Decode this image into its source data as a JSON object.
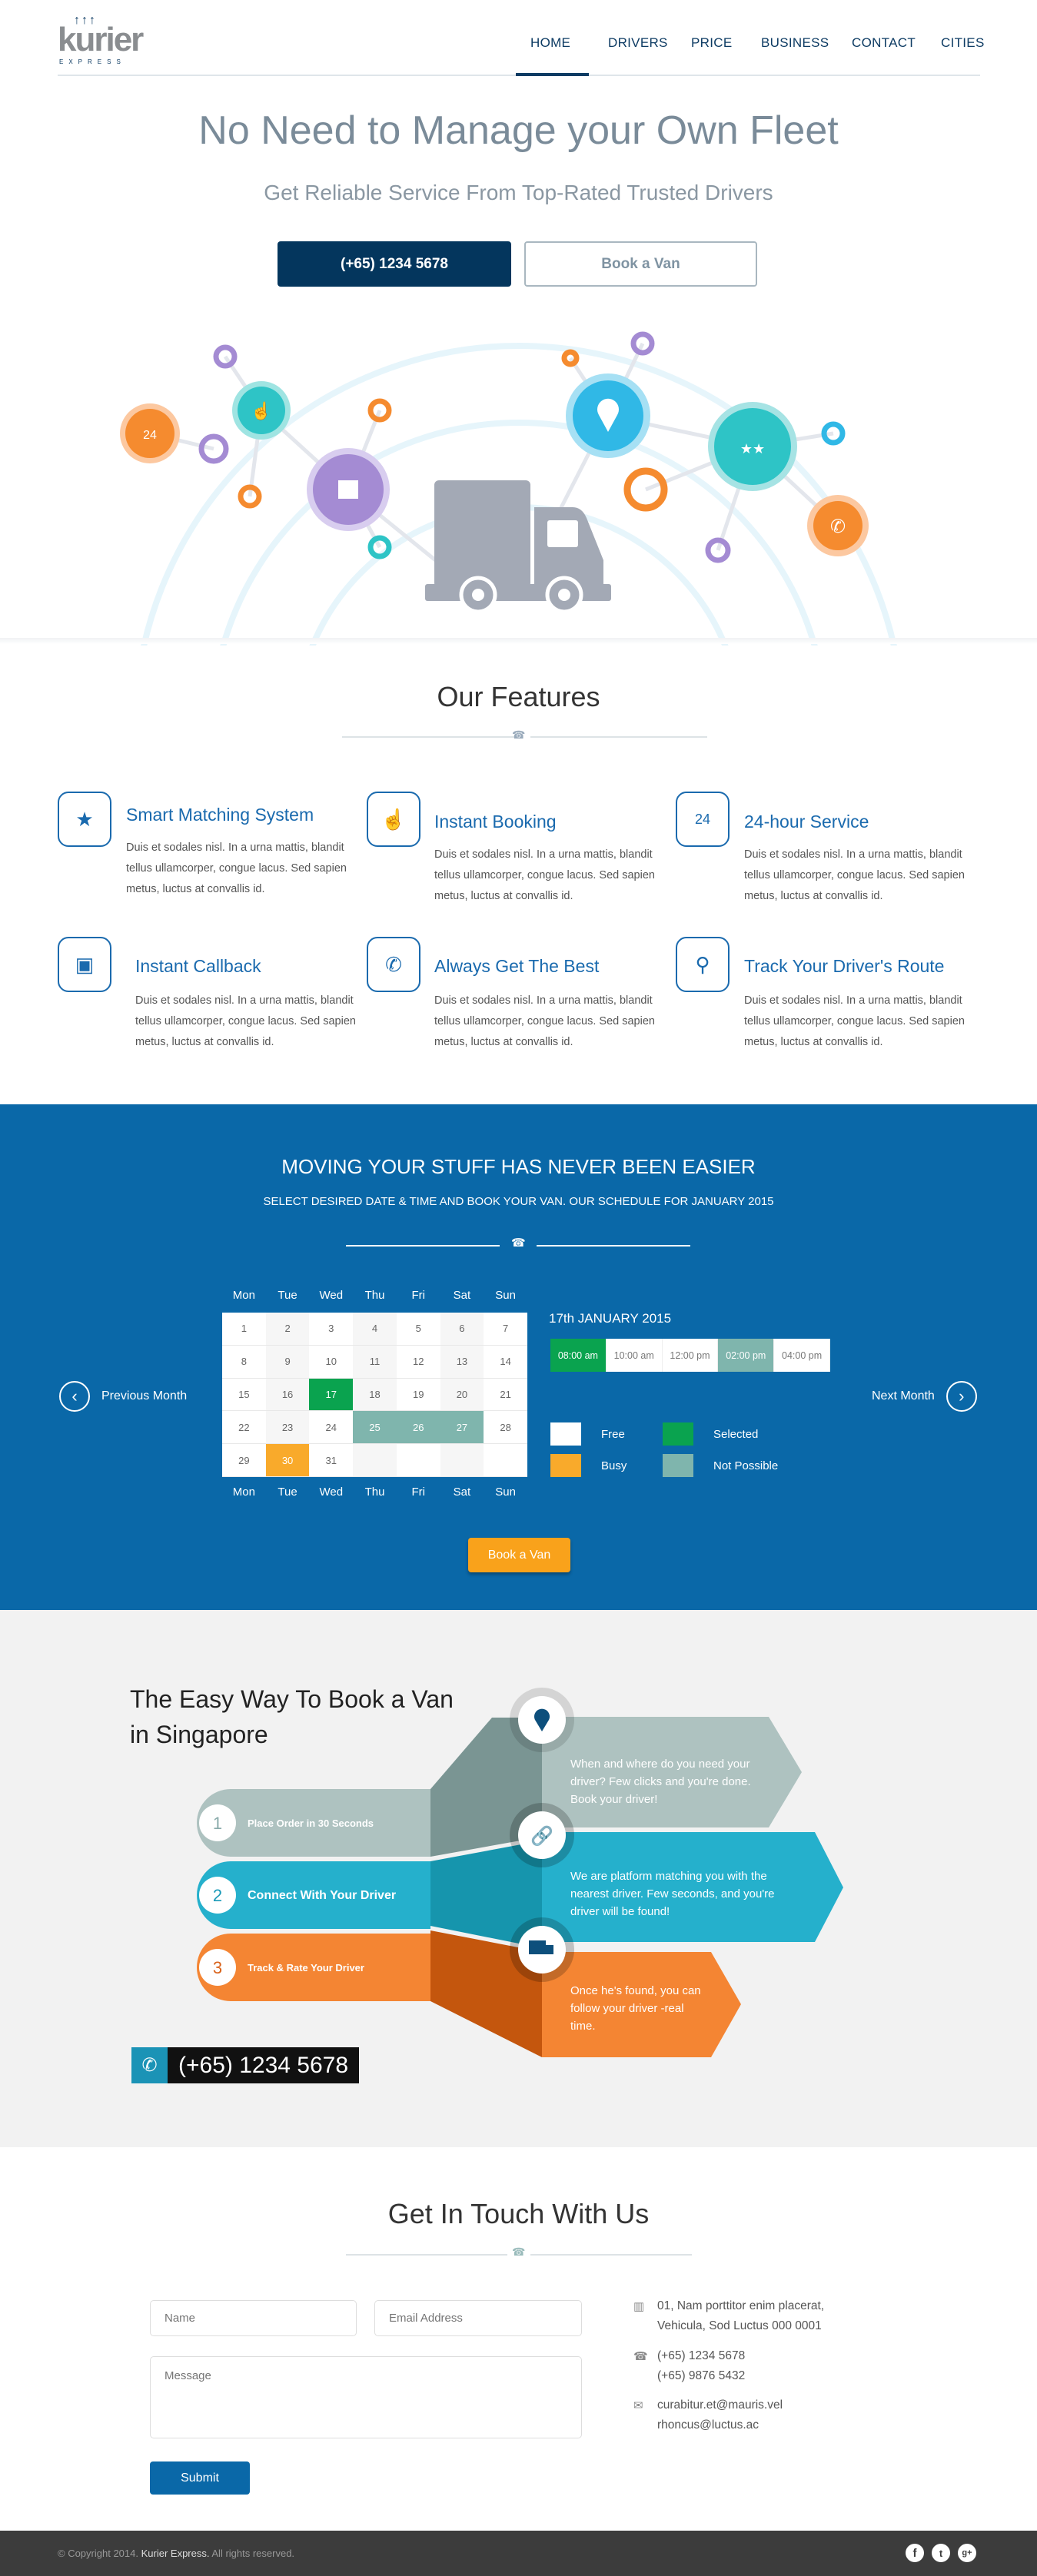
{
  "brand": {
    "name": "kurier",
    "tagline": "EXPRESS"
  },
  "nav": {
    "items": [
      "HOME",
      "DRIVERS",
      "PRICE",
      "BUSINESS",
      "CONTACT",
      "CITIES"
    ],
    "active": "HOME"
  },
  "hero": {
    "title": "No Need to Manage your Own Fleet",
    "subtitle": "Get Reliable Service From Top-Rated Trusted Drivers",
    "phone_button": "(+65) 1234 5678",
    "book_button": "Book a Van"
  },
  "features": {
    "title": "Our Features",
    "items": [
      {
        "icon": "stars-icon",
        "title": "Smart Matching System",
        "text": "Duis et sodales nisl. In a urna mattis, blandit tellus ullamcorper, congue lacus. Sed sapien metus, luctus at convallis id."
      },
      {
        "icon": "hand-pointer-icon",
        "title": "Instant Booking",
        "text": "Duis et sodales nisl. In a urna mattis, blandit tellus ullamcorper, congue lacus. Sed sapien metus, luctus at convallis id."
      },
      {
        "icon": "phone-24-icon",
        "title": "24-hour Service",
        "text": "Duis et sodales nisl. In a urna mattis, blandit tellus ullamcorper, congue lacus. Sed sapien metus, luctus at convallis id."
      },
      {
        "icon": "box-icon",
        "title": "Instant Callback",
        "text": "Duis et sodales nisl. In a urna mattis, blandit tellus ullamcorper, congue lacus. Sed sapien metus, luctus at convallis id."
      },
      {
        "icon": "phone-icon",
        "title": "Always Get The Best",
        "text": "Duis et sodales nisl. In a urna mattis, blandit tellus ullamcorper, congue lacus. Sed sapien metus, luctus at convallis id."
      },
      {
        "icon": "map-pin-icon",
        "title": "Track Your Driver's Route",
        "text": "Duis et sodales nisl. In a urna mattis, blandit tellus ullamcorper, congue lacus. Sed sapien metus, luctus at convallis id."
      }
    ]
  },
  "booking": {
    "title": "MOVING YOUR STUFF HAS NEVER BEEN EASIER",
    "subtitle": "SELECT DESIRED DATE & TIME AND BOOK YOUR VAN. OUR SCHEDULE FOR JANUARY 2015",
    "weekdays": [
      "Mon",
      "Tue",
      "Wed",
      "Thu",
      "Fri",
      "Sat",
      "Sun"
    ],
    "prev": "Previous Month",
    "next": "Next Month",
    "selected_date": "17th JANUARY 2015",
    "days": [
      1,
      2,
      3,
      4,
      5,
      6,
      7,
      8,
      9,
      10,
      11,
      12,
      13,
      14,
      15,
      16,
      17,
      18,
      19,
      20,
      21,
      22,
      23,
      24,
      25,
      26,
      27,
      28,
      29,
      30,
      31
    ],
    "day_status": {
      "17": "selected",
      "25": "np",
      "26": "np",
      "27": "np",
      "30": "busy"
    },
    "slots": [
      {
        "time": "08:00 am",
        "status": "selected"
      },
      {
        "time": "10:00 am",
        "status": "free"
      },
      {
        "time": "12:00 pm",
        "status": "free"
      },
      {
        "time": "02:00 pm",
        "status": "np"
      },
      {
        "time": "04:00 pm",
        "status": "free"
      }
    ],
    "legend": [
      {
        "label": "Free",
        "color": "#ffffff"
      },
      {
        "label": "Selected",
        "color": "#0aa34f"
      },
      {
        "label": "Busy",
        "color": "#f9aa2b"
      },
      {
        "label": "Not Possible",
        "color": "#7fb5ad"
      }
    ],
    "book_button": "Book a Van"
  },
  "steps": {
    "title_line1": "The Easy Way To Book a Van",
    "title_line2": "in Singapore",
    "items": [
      {
        "num": "1",
        "label": "Place Order in 30 Seconds",
        "desc": [
          "When and where do you need your",
          "driver? Few clicks and you're done.",
          "Book your driver!"
        ]
      },
      {
        "num": "2",
        "label": "Connect With Your Driver",
        "desc": [
          "We are platform matching you with the",
          "nearest driver. Few seconds, and you're",
          "driver will be found!"
        ]
      },
      {
        "num": "3",
        "label": "Track & Rate Your Driver",
        "desc": [
          "Once he's found, you can",
          "follow your driver -real",
          "time."
        ]
      }
    ],
    "phone": "(+65) 1234 5678"
  },
  "contact": {
    "title": "Get In Touch With Us",
    "name_placeholder": "Name",
    "email_placeholder": "Email Address",
    "message_placeholder": "Message",
    "submit": "Submit",
    "address": [
      "01, Nam porttitor enim placerat,",
      "Vehicula, Sod Luctus 000 0001"
    ],
    "phones": [
      "(+65) 1234 5678",
      "(+65) 9876 5432"
    ],
    "emails": [
      "curabitur.et@mauris.vel",
      "rhoncus@luctus.ac"
    ]
  },
  "footer": {
    "copy": "© Copyright 2014.",
    "company": "Kurier Express.",
    "rights": "All rights reserved.",
    "social": [
      "facebook-icon",
      "twitter-icon",
      "google-plus-icon"
    ]
  },
  "colors": {
    "navy": "#0d3b63",
    "blue": "#0a68a8",
    "orange": "#f9aa2b",
    "green": "#0aa34f"
  }
}
